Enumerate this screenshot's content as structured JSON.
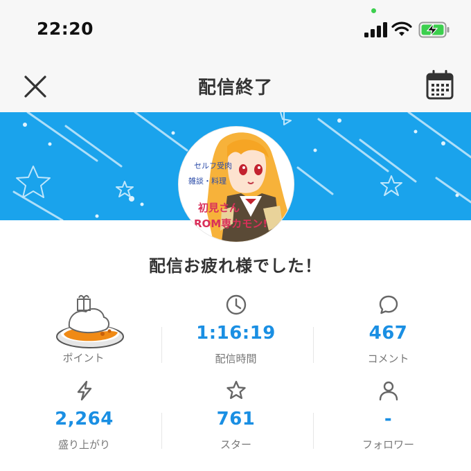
{
  "status_bar": {
    "time": "22:20"
  },
  "header": {
    "title": "配信終了"
  },
  "message": "配信お疲れ様でした！",
  "avatar_text": {
    "line1": "セルフ受肉",
    "line2": "雑談・料理",
    "line3": "初見さん",
    "line4": "ROM専カモン!"
  },
  "stats": {
    "points": {
      "label": "ポイント",
      "icon": "curry-rice-gift-icon"
    },
    "duration": {
      "value": "1:16:19",
      "label": "配信時間",
      "icon": "clock-icon"
    },
    "comments": {
      "value": "467",
      "label": "コメント",
      "icon": "comment-bubble-icon"
    },
    "excitement": {
      "value": "2,264",
      "label": "盛り上がり",
      "icon": "lightning-icon"
    },
    "stars": {
      "value": "761",
      "label": "スター",
      "icon": "star-icon"
    },
    "followers": {
      "value": "-",
      "label": "フォロワー",
      "icon": "person-icon"
    }
  },
  "colors": {
    "accent": "#1a8fe3",
    "banner": "#1aa3ec",
    "battery": "#3ccf4e"
  }
}
